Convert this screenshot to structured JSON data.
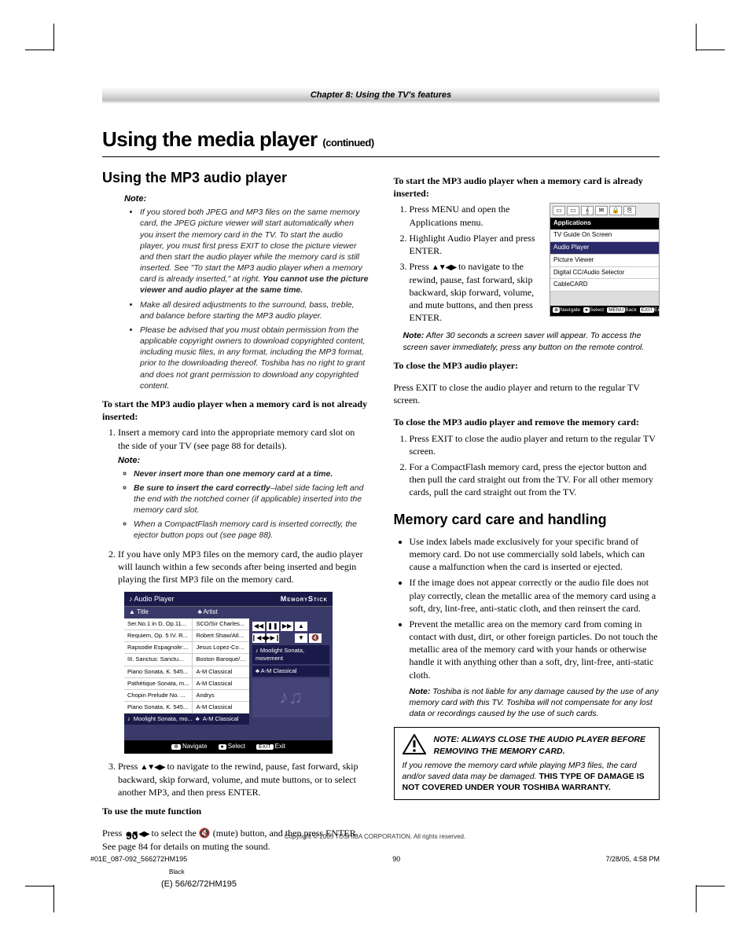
{
  "chapter": "Chapter 8: Using the TV's features",
  "h1": "Using the media player",
  "h1_cont": "(continued)",
  "left": {
    "h2": "Using the MP3 audio player",
    "note_lbl": "Note:",
    "note1_a": "If you stored both JPEG and MP3 files on the same memory card, the JPEG picture viewer will start automatically when you insert the memory card in the TV. To start the audio player, you must first press EXIT to close the picture viewer and then start the audio player while the memory card is still inserted. See \"To start the MP3 audio player when a memory card is already inserted,\" at right. ",
    "note1_b": "You cannot use the picture viewer and audio player at the same time.",
    "note2": "Make all desired adjustments to the surround, bass, treble, and balance before starting the MP3 audio player.",
    "note3": "Please be advised that you must obtain permission from the applicable copyright owners to download copyrighted content, including music files, in any format, including the MP3 format, prior to the downloading thereof. Toshiba has no right to grant and does not grant permission to download any copyrighted content.",
    "lead1": "To start the MP3 audio player when a memory card is not already inserted:",
    "step1": "Insert a memory card into the appropriate memory card slot on the side of your TV (see page 88 for details).",
    "sub_note_lbl": "Note:",
    "sn1": "Never insert more than one memory card at a time.",
    "sn2a": "Be sure to insert the card correctly",
    "sn2b": "–label side facing left and the end with the notched corner (if applicable) inserted into the memory card slot.",
    "sn3": "When a CompactFlash memory card is inserted correctly, the ejector button pops out (see page 88).",
    "step2": "If you have only MP3 files on the memory card, the audio player will launch within a few seconds after being inserted and begin playing the first MP3 file on the memory card.",
    "step3a": "Press ",
    "step3b": " to navigate to the rewind, pause, fast forward, skip backward, skip forward, volume, and mute buttons, or to select another MP3, and then press ENTER.",
    "lead2": "To use the mute function",
    "mute_a": "Press ",
    "mute_b": " to select the ",
    "mute_c": " (mute) button, and then press ENTER. See page 84 for details on muting the sound."
  },
  "player": {
    "title": "Audio Player",
    "brand": "MemoryStick",
    "col1": "Title",
    "col2": "Artist",
    "rows": [
      {
        "t": "Ser.No.1 in D, Op.11...",
        "a": "SCO/Sir Charles..."
      },
      {
        "t": "Requiem, Op. 5 IV. R...",
        "a": "Robert Shaw/Atla..."
      },
      {
        "t": "Rapsodie Espagnole:...",
        "a": "Jesus Lopez-Cobo..."
      },
      {
        "t": "III. Sanctus: Sanctu...",
        "a": "Boston Baroque/M..."
      },
      {
        "t": "Piano Sonata, K. 545...",
        "a": "A-M Classical"
      },
      {
        "t": "Pathétique Sonata, m...",
        "a": "A-M Classical"
      },
      {
        "t": "Chopin Prelude No. ...",
        "a": "Andrys"
      },
      {
        "t": "Piano Sonata, K. 545...",
        "a": "A-M Classical"
      }
    ],
    "now_t": "Moolight Sonata, mo...",
    "now_a": "A-M Classical",
    "tag1": "Moolight Sonata, movement",
    "tag2": "A-M Classical",
    "foot_nav": "Navigate",
    "foot_sel": "Select",
    "foot_exit": "Exit"
  },
  "right": {
    "lead1": "To start the MP3 audio player when a memory card is already inserted:",
    "s1": "Press MENU and open the Applications menu.",
    "s2": "Highlight Audio Player and press ENTER.",
    "s3a": "Press ",
    "s3b": " to navigate to the rewind, pause, fast forward, skip backward, skip forward, volume, and mute buttons, and then press ENTER.",
    "note_lbl": "Note:",
    "note1": " After 30 seconds a screen saver will appear.  To access the screen saver immediately, press any button on the remote control.",
    "lead2": "To close the MP3 audio player:",
    "p2": "Press EXIT to close the audio player and return to the regular TV screen.",
    "lead3": "To close the MP3 audio player and remove the memory card:",
    "s3_1": "Press EXIT to close the audio player and return to the regular TV screen.",
    "s3_2": "For a CompactFlash memory card, press the ejector button and then pull the card straight out from the TV. For all other memory cards, pull the card straight out from the TV.",
    "h2": "Memory card care and handling",
    "b1": "Use index labels made exclusively for your specific brand of memory card. Do not use commercially sold labels, which can cause a malfunction when the card is inserted or ejected.",
    "b2": "If the image does not appear correctly or the audio file does not play correctly, clean the metallic area of the memory card using a soft, dry, lint-free, anti-static cloth, and then reinsert the card.",
    "b3": "Prevent the metallic area on the memory card from coming in contact with dust, dirt, or other foreign particles. Do not touch the metallic area of the memory card with your hands or otherwise handle it with anything other than a soft, dry, lint-free, anti-static cloth.",
    "b3_note_lbl": "Note:",
    "b3_note": " Toshiba is not liable for any damage caused by the use of any memory card with this TV. Toshiba will not compensate for any lost data or recordings caused by the use of such cards.",
    "warn_title": "NOTE: ALWAYS CLOSE THE AUDIO PLAYER BEFORE REMOVING THE MEMORY CARD.",
    "warn_body_a": "If you remove the memory card while playing MP3 files, the card and/or saved data may be damaged. ",
    "warn_body_b": "THIS TYPE OF DAMAGE IS NOT COVERED UNDER YOUR TOSHIBA WARRANTY."
  },
  "app": {
    "hd": "Applications",
    "items": [
      "TV Guide On Screen",
      "Audio Player",
      "Picture Viewer",
      "Digital CC/Audio Selector",
      "CableCARD"
    ],
    "foot_nav": "Navigate",
    "foot_sel": "Select",
    "foot_back": "Back",
    "foot_exit": "Exit"
  },
  "pagenum": "90",
  "copyright": "Copyright © 2005 TOSHIBA CORPORATION. All rights reserved.",
  "foot_file": "#01E_087-092_566272HM195",
  "foot_pg": "90",
  "foot_date": "7/28/05, 4:58 PM",
  "black": "Black",
  "model": "(E) 56/62/72HM195"
}
